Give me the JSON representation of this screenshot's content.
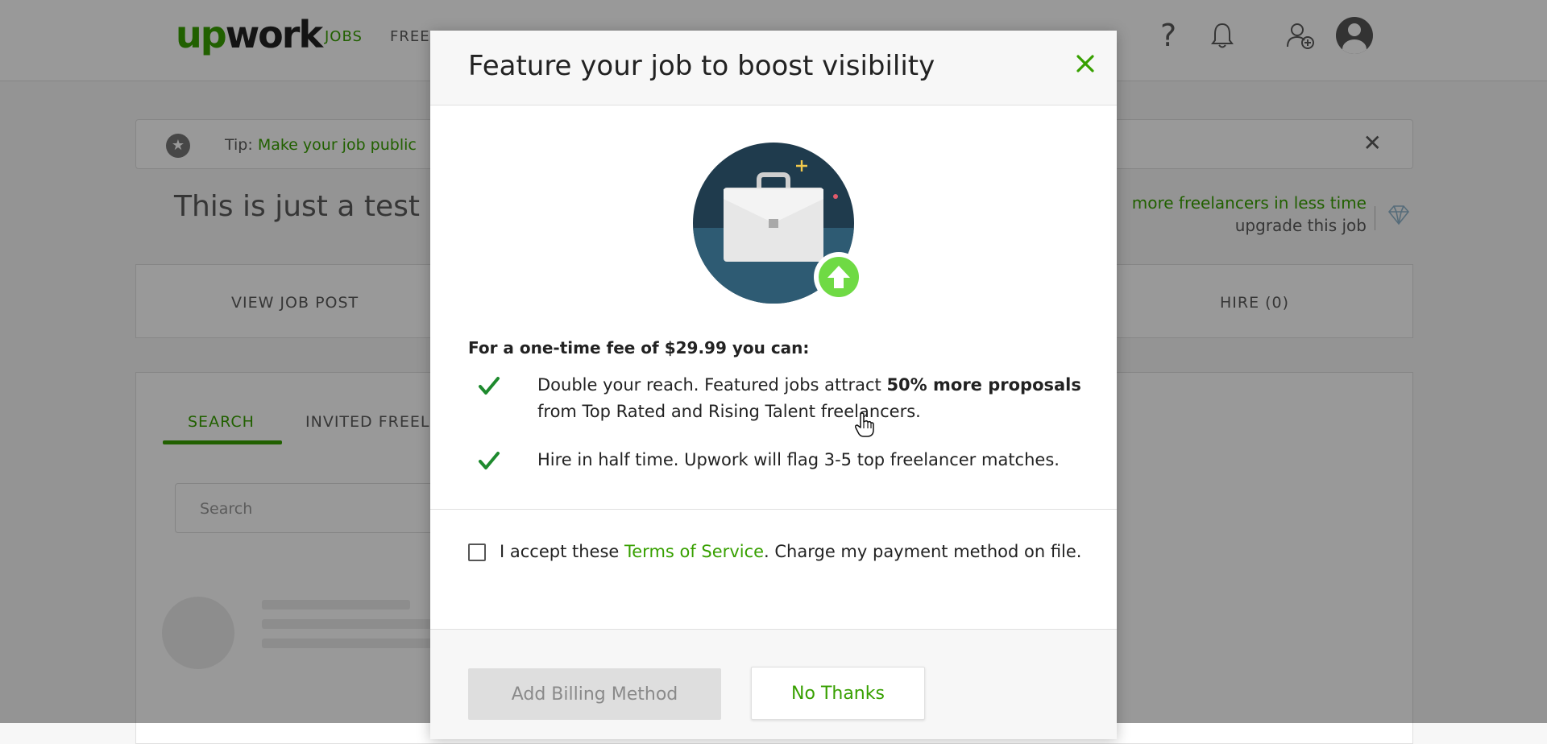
{
  "background": {
    "logo": {
      "up": "up",
      "work": "work"
    },
    "nav": {
      "jobs": "JOBS",
      "freelancers": "FREE"
    },
    "tip": {
      "prefix": "Tip:",
      "link": "Make your job public"
    },
    "job_title": "This is just a test p",
    "upgrade": {
      "line1": "more freelancers in less time",
      "line2": "upgrade this job"
    },
    "tabs": {
      "view_job_post": "VIEW JOB POST",
      "hire": "HIRE (0)"
    },
    "search_tabs": {
      "search": "SEARCH",
      "invited": "INVITED FREEL"
    },
    "search_placeholder": "Search"
  },
  "modal": {
    "title": "Feature your job to boost visibility",
    "fee_line": "For a one-time fee of $29.99 you can:",
    "bullets": [
      {
        "pre": "Double your reach. Featured jobs attract ",
        "bold": "50% more proposals",
        "post": " from Top Rated and Rising Talent freelancers."
      },
      {
        "pre": "Hire in half time. Upwork will flag 3-5 top freelancer matches.",
        "bold": "",
        "post": ""
      }
    ],
    "accept": {
      "pre": "I accept these ",
      "link": "Terms of Service",
      "post": ". Charge my payment method on file."
    },
    "buttons": {
      "add_billing": "Add Billing Method",
      "no_thanks": "No Thanks"
    }
  },
  "colors": {
    "brand_green": "#37a000",
    "arrow_green": "#6fda44",
    "illustration_blue": "#2e5b73"
  },
  "icons": [
    "close-icon",
    "briefcase-icon",
    "up-arrow-icon",
    "check-icon",
    "help-icon",
    "bell-icon",
    "add-user-icon",
    "diamond-icon",
    "star-icon"
  ]
}
